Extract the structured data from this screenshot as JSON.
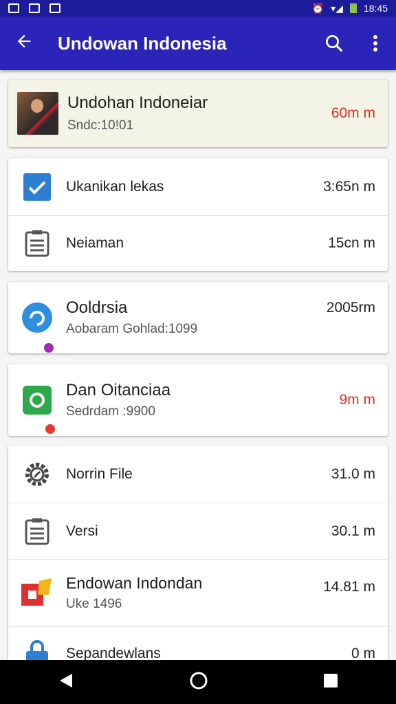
{
  "status_bar": {
    "time": "18:45"
  },
  "app_bar": {
    "title": "Undowan Indonesia"
  },
  "header_card": {
    "title": "Undohan Indoneiar",
    "subtitle": "Sndc:10!01",
    "meta": "60m m"
  },
  "card1": [
    {
      "label": "Ukanikan lekas",
      "meta": "3:65n m",
      "icon": "checkbox-icon"
    },
    {
      "label": "Neiaman",
      "meta": "15cn m",
      "icon": "document-icon"
    }
  ],
  "card2": {
    "title": "Ooldrsia",
    "subtitle": "Aobaram Gohlad:1099",
    "meta": "2005rm",
    "icon": "sync-icon"
  },
  "card3": {
    "title": "Dan Oitanciaa",
    "subtitle": "Sedrdam :9900",
    "meta": "9m m",
    "icon": "app-icon"
  },
  "list": [
    {
      "label": "Norrin File",
      "meta": "31.0 m",
      "icon": "gear-icon"
    },
    {
      "label": "Versi",
      "meta": "30.1 m",
      "icon": "document-icon"
    },
    {
      "label": "Endowan Indondan",
      "sub": "Uke 1496",
      "meta": "14.81 m",
      "icon": "gallery-icon"
    },
    {
      "label": "Sepandewlans",
      "meta": "0 m",
      "icon": "lock-icon"
    }
  ]
}
